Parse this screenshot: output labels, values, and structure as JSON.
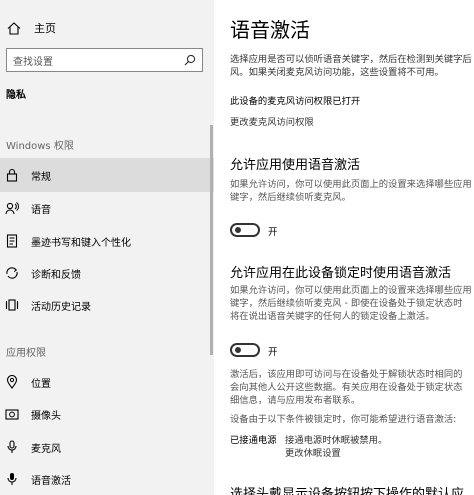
{
  "sidebar": {
    "home_label": "主页",
    "search_placeholder": "查找设置",
    "privacy_label": "隐私",
    "windows_permissions_title": "Windows 权限",
    "app_permissions_title": "应用权限",
    "items": [
      {
        "label": "常规",
        "icon": "lock-icon",
        "active": true
      },
      {
        "label": "语音",
        "icon": "speech-icon"
      },
      {
        "label": "墨迹书写和键入个性化",
        "icon": "ink-icon"
      },
      {
        "label": "诊断和反馈",
        "icon": "diagnostics-icon"
      },
      {
        "label": "活动历史记录",
        "icon": "activity-history-icon"
      }
    ],
    "app_items": [
      {
        "label": "位置",
        "icon": "location-icon"
      },
      {
        "label": "摄像头",
        "icon": "camera-icon"
      },
      {
        "label": "麦克风",
        "icon": "microphone-icon"
      },
      {
        "label": "语音激活",
        "icon": "voice-activation-icon"
      }
    ]
  },
  "main": {
    "title": "语音激活",
    "intro_line1": "选择应用是否可以侦听语音关键字，然后在检测到关键字后",
    "intro_line2": "风。如果关闭麦克风访问功能，这些设置将不可用。",
    "mic_access_status": "此设备的麦克风访问权限已打开",
    "change_mic_access_link": "更改麦克风访问权限",
    "section1": {
      "heading": "允许应用使用语音激活",
      "desc_line1": "如果允许访问，你可以使用此页面上的设置来选择哪些应用",
      "desc_line2": "键字，然后继续侦听麦克风。",
      "toggle_label": "开",
      "toggle_on": true
    },
    "section2": {
      "heading": "允许应用在此设备锁定时使用语音激活",
      "desc_line1": "如果允许访问，你可以使用此页面上的设置来选择哪些应用",
      "desc_line2": "键字，然后继续侦听麦克风 - 即使在设备处于锁定状态时",
      "desc_line3": "将在说出语音关键字的任何人的锁定设备上激活。",
      "toggle_label": "开",
      "toggle_on": true
    },
    "note_line1": "激活后，该应用即可访问与在设备处于解锁状态时相同的",
    "note_line2": "会向其他人公开这些数据。有关应用在设备处于锁定状态",
    "note_line3": "细信息，请与应用发布者联系。",
    "condition_text": "设备由于以下条件被锁定时，你可能希望进行语音激活:",
    "power_key": "已接通电源",
    "power_value": "接通电源时休眠被禁用。",
    "change_sleep_link": "更改休眠设置",
    "cut_heading": "选择头戴显示设备按钮按下操作的默认应"
  }
}
